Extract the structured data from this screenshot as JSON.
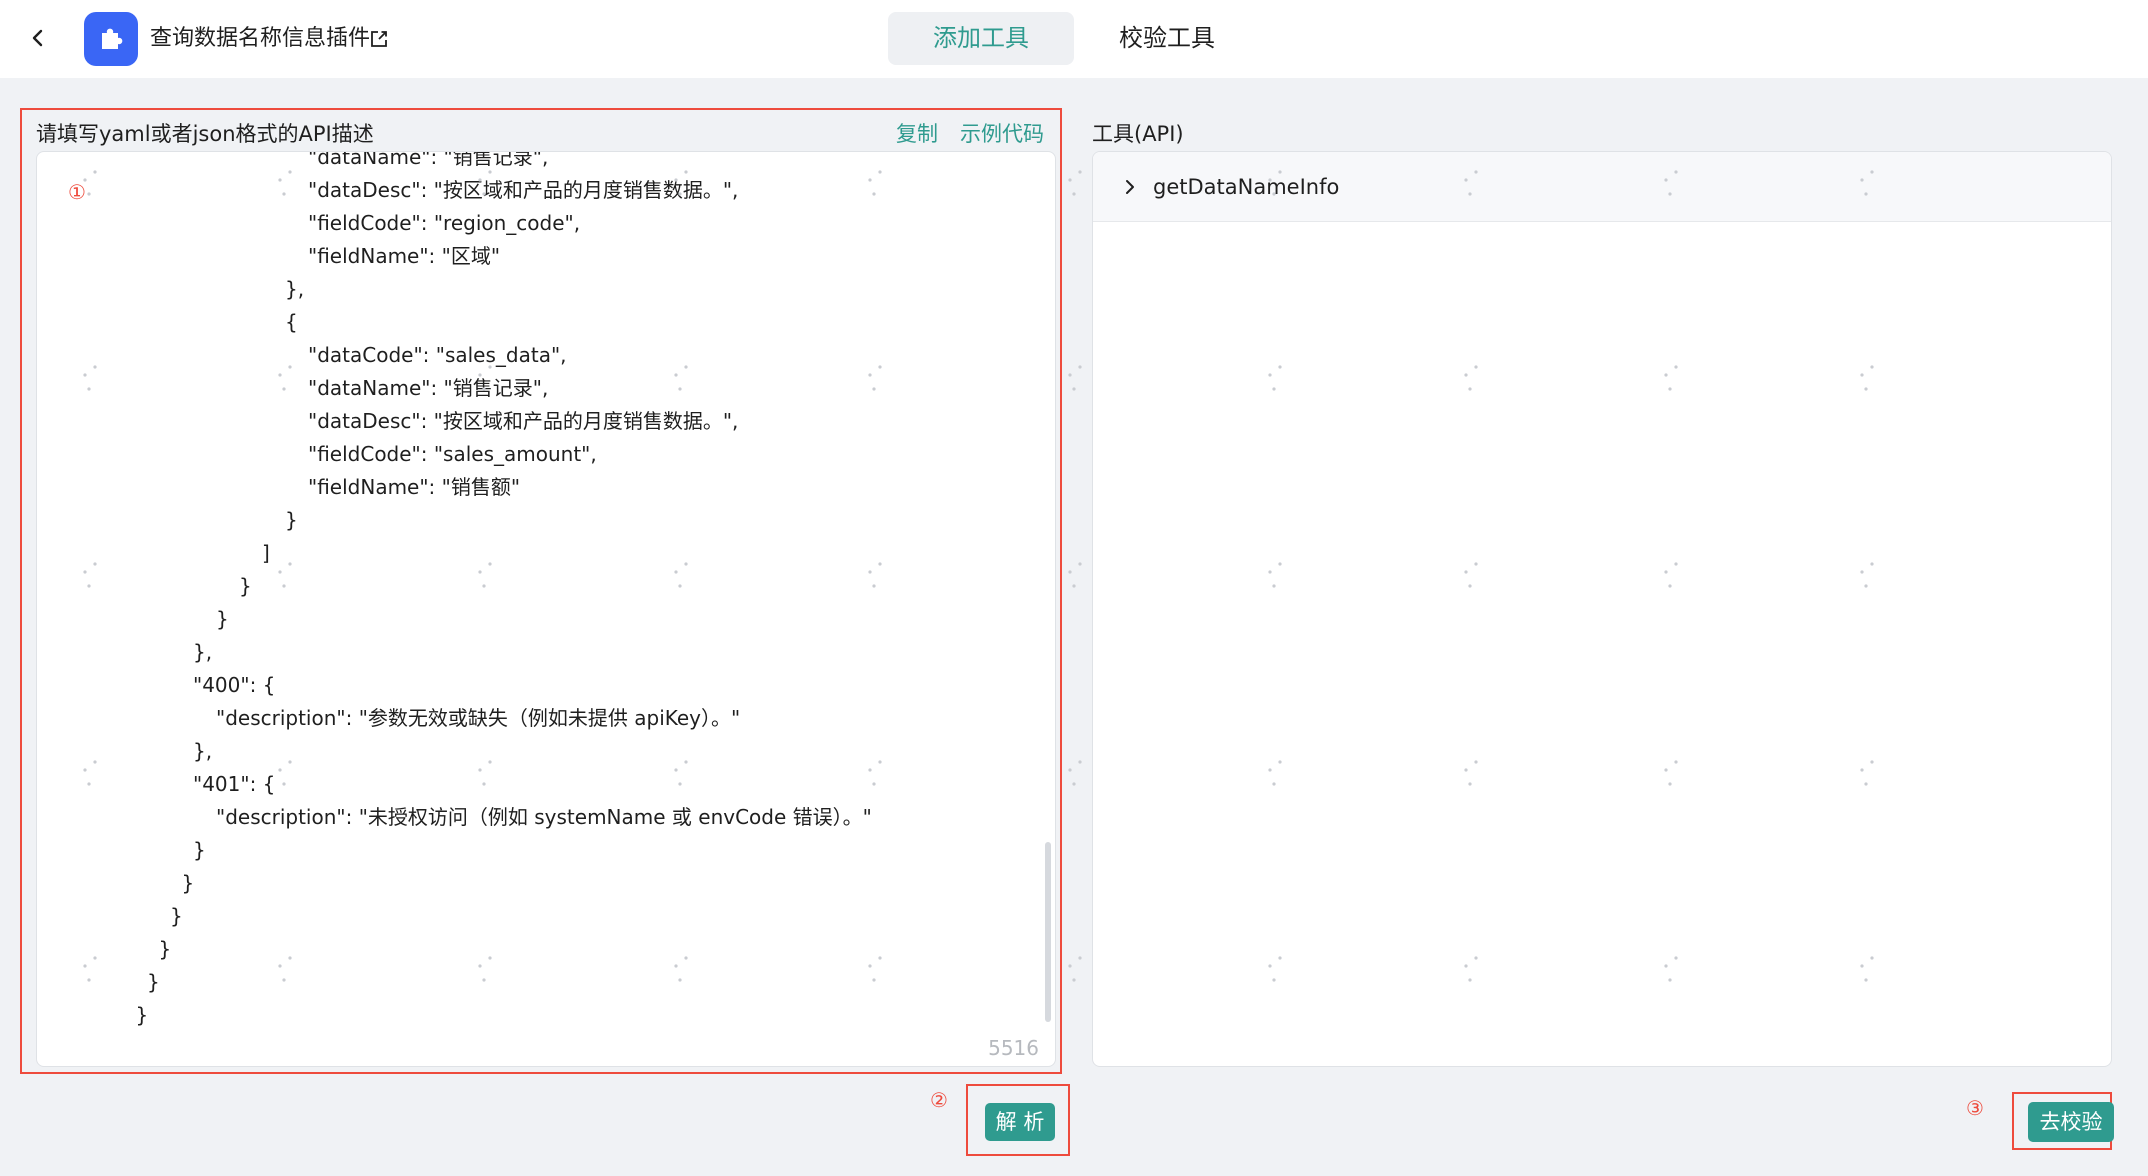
{
  "header": {
    "plugin_title": "查询数据名称信息插件",
    "tabs": [
      {
        "label": "添加工具",
        "active": true
      },
      {
        "label": "校验工具",
        "active": false
      }
    ]
  },
  "editor": {
    "label": "请填写yaml或者json格式的API描述",
    "copy_label": "复制",
    "example_label": "示例代码",
    "char_count": "5516",
    "lines": [
      {
        "indent": 6,
        "text": "\"dataName\": \"销售记录\","
      },
      {
        "indent": 6,
        "text": "\"dataDesc\": \"按区域和产品的月度销售数据。\","
      },
      {
        "indent": 6,
        "text": "\"fieldCode\": \"region_code\","
      },
      {
        "indent": 6,
        "text": "\"fieldName\": \"区域\""
      },
      {
        "indent": 5,
        "text": "},"
      },
      {
        "indent": 5,
        "text": "{"
      },
      {
        "indent": 6,
        "text": "\"dataCode\": \"sales_data\","
      },
      {
        "indent": 6,
        "text": "\"dataName\": \"销售记录\","
      },
      {
        "indent": 6,
        "text": "\"dataDesc\": \"按区域和产品的月度销售数据。\","
      },
      {
        "indent": 6,
        "text": "\"fieldCode\": \"sales_amount\","
      },
      {
        "indent": 6,
        "text": "\"fieldName\": \"销售额\""
      },
      {
        "indent": 5,
        "text": "}"
      },
      {
        "indent": 4,
        "text": "]"
      },
      {
        "indent": 3,
        "text": "}"
      },
      {
        "indent": 2,
        "text": "}"
      },
      {
        "indent": 1,
        "text": "},"
      },
      {
        "indent": 1,
        "text": "\"400\": {"
      },
      {
        "indent": 2,
        "text": "\"description\": \"参数无效或缺失（例如未提供 apiKey）。\""
      },
      {
        "indent": 1,
        "text": "},"
      },
      {
        "indent": 1,
        "text": "\"401\": {"
      },
      {
        "indent": 2,
        "text": "\"description\": \"未授权访问（例如 systemName 或 envCode 错误）。\""
      },
      {
        "indent": 1,
        "text": "}"
      },
      {
        "indent": 0.5,
        "text": "}"
      },
      {
        "indent": 0,
        "text": "}"
      },
      {
        "indent": -0.5,
        "text": "}"
      },
      {
        "indent": -1,
        "text": "}"
      },
      {
        "indent": -1.5,
        "text": "}"
      }
    ]
  },
  "tools": {
    "label": "工具(API)",
    "items": [
      {
        "name": "getDataNameInfo"
      }
    ]
  },
  "actions": {
    "parse_label": "解 析",
    "verify_label": "去校验"
  },
  "markers": {
    "one": "①",
    "two": "②",
    "three": "③"
  },
  "colors": {
    "accent": "#2f9b8f",
    "logo": "#3a66f5",
    "annotation": "#ee4b3d"
  }
}
